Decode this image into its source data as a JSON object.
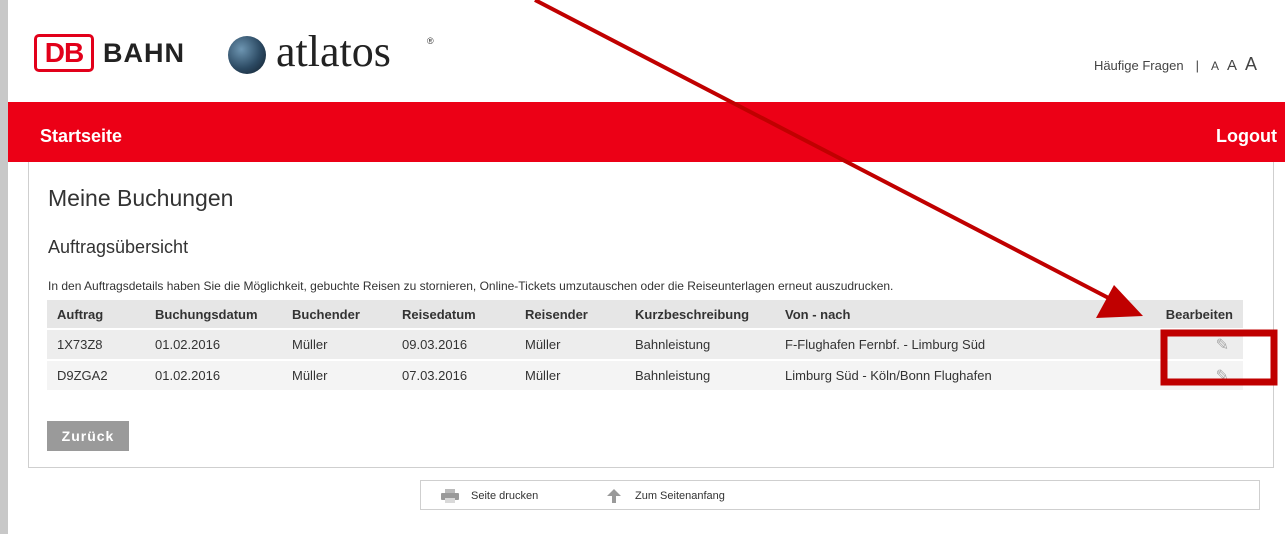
{
  "header": {
    "db_logo": "DB",
    "bahn": "BAHN",
    "atlatos": "atlatos",
    "trademark": "®",
    "faq": "Häufige Fragen",
    "separator": "|",
    "font_small": "A",
    "font_medium": "A",
    "font_large": "A"
  },
  "nav": {
    "home": "Startseite",
    "logout": "Logout"
  },
  "main": {
    "title": "Meine Buchungen",
    "subtitle": "Auftragsübersicht",
    "info": "In den Auftragsdetails haben Sie die Möglichkeit, gebuchte Reisen zu stornieren, Online-Tickets umzutauschen oder die Reiseunterlagen erneut auszudrucken."
  },
  "table": {
    "columns": [
      "Auftrag",
      "Buchungsdatum",
      "Buchender",
      "Reisedatum",
      "Reisender",
      "Kurzbeschreibung",
      "Von - nach",
      "Bearbeiten"
    ],
    "rows": [
      [
        "1X73Z8",
        "01.02.2016",
        "Müller",
        "09.03.2016",
        "Müller",
        "Bahnleistung",
        "F-Flughafen Fernbf. - Limburg Süd"
      ],
      [
        "D9ZGA2",
        "01.02.2016",
        "Müller",
        "07.03.2016",
        "Müller",
        "Bahnleistung",
        "Limburg Süd - Köln/Bonn Flughafen"
      ]
    ],
    "edit_icon": "pencil-icon"
  },
  "back_button": "Zurück",
  "footer": {
    "print": "Seite drucken",
    "top": "Zum Seitenanfang"
  },
  "colors": {
    "brand_red": "#ec0016",
    "annotation_red": "#c00000"
  }
}
